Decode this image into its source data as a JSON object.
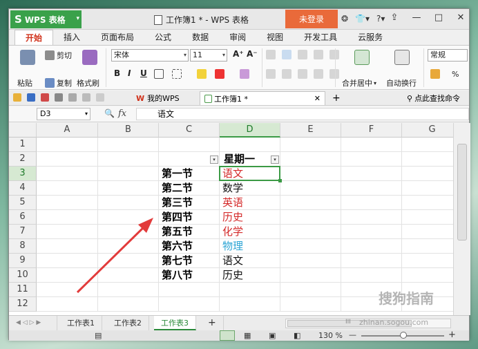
{
  "app": {
    "name": "WPS 表格",
    "logo_glyph": "S",
    "caret_glyph": "▾",
    "doc_title": "工作簿1 * - WPS 表格",
    "login_label": "未登录",
    "title_icons": [
      "❂",
      "👕▾",
      "?▾"
    ],
    "win_controls": [
      "⇪",
      "—",
      "□",
      "✕"
    ]
  },
  "tabs": [
    {
      "label": "开始",
      "active": true
    },
    {
      "label": "插入"
    },
    {
      "label": "页面布局"
    },
    {
      "label": "公式"
    },
    {
      "label": "数据"
    },
    {
      "label": "审阅"
    },
    {
      "label": "视图"
    },
    {
      "label": "开发工具"
    },
    {
      "label": "云服务"
    }
  ],
  "ribbon": {
    "paste": "粘贴",
    "cut": "剪切",
    "copy": "复制",
    "format_painter": "格式刷",
    "font_name": "宋体",
    "font_size": "11",
    "bold": "B",
    "italic": "I",
    "underline": "U",
    "merge_center": "合并居中",
    "wrap_text": "自动换行",
    "number_format": "常规",
    "percent": "%",
    "grow_font": "A⁺",
    "shrink_font": "A⁻",
    "dropdown_glyph": "▾"
  },
  "docbar": {
    "my_wps": "我的WPS",
    "workbook": "工作簿1 *",
    "close": "✕",
    "add": "+",
    "search": "点此查找命令"
  },
  "formula_bar": {
    "cell_ref": "D3",
    "zoom_glyph": "🔍",
    "fx_label": "fx",
    "content": "语文"
  },
  "grid": {
    "columns": [
      "A",
      "B",
      "C",
      "D",
      "E",
      "F",
      "G"
    ],
    "rows": [
      "1",
      "2",
      "3",
      "4",
      "5",
      "6",
      "7",
      "8",
      "9",
      "10",
      "11",
      "12"
    ],
    "selected_col": "D",
    "selected_row": "3",
    "header_cell": "星期一",
    "filter_glyph": "▾",
    "c_values": [
      "第一节",
      "第二节",
      "第三节",
      "第四节",
      "第五节",
      "第六节",
      "第七节",
      "第八节"
    ],
    "d_values": [
      {
        "text": "语文",
        "color": "#d42a2a"
      },
      {
        "text": "数学",
        "color": "#111111"
      },
      {
        "text": "英语",
        "color": "#d42a2a"
      },
      {
        "text": "历史",
        "color": "#d42a2a"
      },
      {
        "text": "化学",
        "color": "#d42a2a"
      },
      {
        "text": "物理",
        "color": "#2aa4d4"
      },
      {
        "text": "语文",
        "color": "#111111"
      },
      {
        "text": "历史",
        "color": "#111111"
      }
    ]
  },
  "sheets": [
    {
      "label": "工作表1"
    },
    {
      "label": "工作表2"
    },
    {
      "label": "工作表3",
      "active": true
    }
  ],
  "sheetbar": {
    "add": "+",
    "nav_glyphs": "◀ ◁ ▷ ▶",
    "scroll_glyph": "III"
  },
  "status": {
    "zoom": "130 %",
    "zoom_minus": "—",
    "zoom_plus": "+"
  },
  "watermark": {
    "brand": "搜狗指南",
    "url": "zhinan.sogou.com"
  },
  "colors": {
    "accent_green": "#3aa14a",
    "login_orange": "#e96a3a",
    "tab_red": "#d0321b"
  }
}
